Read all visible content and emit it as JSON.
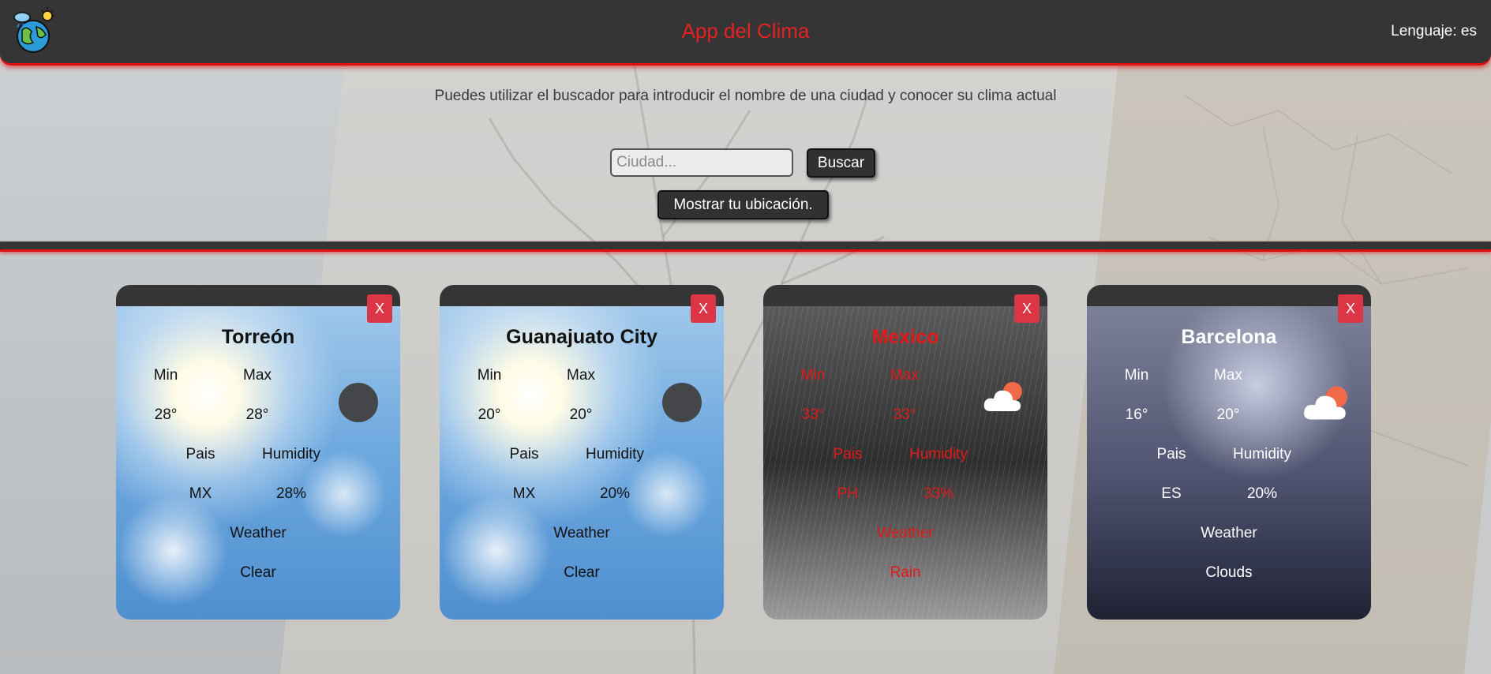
{
  "header": {
    "title": "App del Clima",
    "language_label": "Lenguaje:",
    "language_value": "es"
  },
  "intro_text": "Puedes utilizar el buscador para introducir el nombre de una ciudad y conocer su clima actual",
  "search": {
    "placeholder": "Ciudad...",
    "value": "",
    "button_label": "Buscar",
    "location_button_label": "Mostrar tu ubicación."
  },
  "cards": [
    {
      "city": "Torreón",
      "close_label": "X",
      "min_label": "Min",
      "max_label": "Max",
      "min_value": "28°",
      "max_value": "28°",
      "country_label": "Pais",
      "humidity_label": "Humidity",
      "country_value": "MX",
      "humidity_value": "28%",
      "weather_label": "Weather",
      "weather_value": "Clear",
      "icon": "clear-icon",
      "background": "sunny"
    },
    {
      "city": "Guanajuato City",
      "close_label": "X",
      "min_label": "Min",
      "max_label": "Max",
      "min_value": "20°",
      "max_value": "20°",
      "country_label": "Pais",
      "humidity_label": "Humidity",
      "country_value": "MX",
      "humidity_value": "20%",
      "weather_label": "Weather",
      "weather_value": "Clear",
      "icon": "clear-icon",
      "background": "sunny"
    },
    {
      "city": "Mexico",
      "close_label": "X",
      "min_label": "Min",
      "max_label": "Max",
      "min_value": "33°",
      "max_value": "33°",
      "country_label": "Pais",
      "humidity_label": "Humidity",
      "country_value": "PH",
      "humidity_value": "33%",
      "weather_label": "Weather",
      "weather_value": "Rain",
      "icon": "partly-cloudy-icon",
      "background": "rain"
    },
    {
      "city": "Barcelona",
      "close_label": "X",
      "min_label": "Min",
      "max_label": "Max",
      "min_value": "16°",
      "max_value": "20°",
      "country_label": "Pais",
      "humidity_label": "Humidity",
      "country_value": "ES",
      "humidity_value": "20%",
      "weather_label": "Weather",
      "weather_value": "Clouds",
      "icon": "partly-cloudy-icon",
      "background": "storm"
    }
  ],
  "colors": {
    "header_bg": "#353535",
    "accent_red": "#e01010",
    "title_red": "#e52222",
    "close_button": "#dc3545",
    "button_dark": "#2f3133"
  }
}
